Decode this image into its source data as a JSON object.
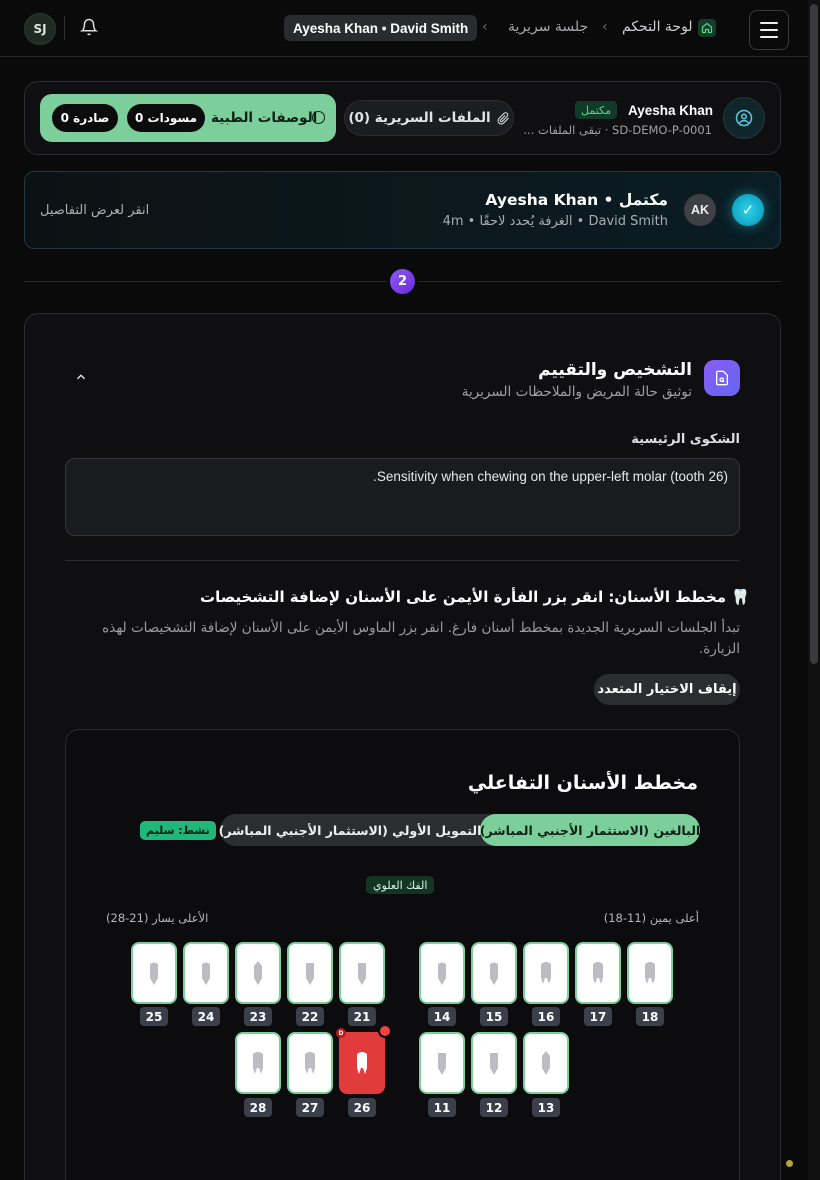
{
  "topbar": {
    "user_initials": "SJ",
    "breadcrumb_names": "Ayesha Khan • David Smith",
    "breadcrumb_session": "جلسة سريرية",
    "breadcrumb_dashboard": "لوحة التحكم"
  },
  "patient": {
    "name": "Ayesha Khan",
    "status": "مكتمل",
    "id_line": "SD-DEMO-P-0001 · تبقى الملفات ...",
    "files_label": "الملفات السريرية (0)",
    "prescriptions_label": "الوصفات الطبية",
    "drafts_label": "0 مسودات",
    "issued_label": "0 صادرة"
  },
  "session": {
    "initials": "AK",
    "title": "Ayesha Khan • مكتمل",
    "subtitle": "4m • الغرفة يُحدد لاحقًا • David Smith",
    "hint": "انقر لعرض التفاصيل"
  },
  "step": {
    "number": "2"
  },
  "diagnosis": {
    "title": "التشخيص والتقييم",
    "subtitle": "توثيق حالة المريض والملاحظات السريرية",
    "complaint_label": "الشكوى الرئيسية",
    "complaint_text": "Sensitivity when chewing on the upper-left molar (tooth 26).",
    "chart_title": "مخطط الأسنان: انقر بزر الفأرة الأيمن على الأسنان لإضافة التشخيصات",
    "chart_help": "تبدأ الجلسات السريرية الجديدة بمخطط أسنان فارغ. انقر بزر الماوس الأيمن على الأسنان لإضافة التشخيصات لهذه الزيارة.",
    "stop_multi_label": "إيقاف الاختيار المتعدد"
  },
  "dental_chart": {
    "title": "مخطط الأسنان التفاعلي",
    "tab_adult": "البالغين (الاستثمار الأجنبي المباشر)",
    "tab_primary": "التمويل الأولي (الاستثمار الأجنبي المباشر)",
    "active_badge": "نشط: سليم",
    "jaw_label": "الفك العلوي",
    "upper_right_label": "أعلى يمين (11-18)",
    "upper_left_label": "الأعلى يسار (21-28)",
    "diagnosed_marker": "D",
    "teeth": {
      "t18": "18",
      "t17": "17",
      "t16": "16",
      "t15": "15",
      "t14": "14",
      "t21": "21",
      "t22": "22",
      "t23": "23",
      "t24": "24",
      "t25": "25",
      "t13": "13",
      "t12": "12",
      "t11": "11",
      "t26": "26",
      "t27": "27",
      "t28": "28"
    },
    "colors": {
      "healthy_border": "#7ccf9a",
      "diagnosed": "#e23b3b"
    }
  }
}
